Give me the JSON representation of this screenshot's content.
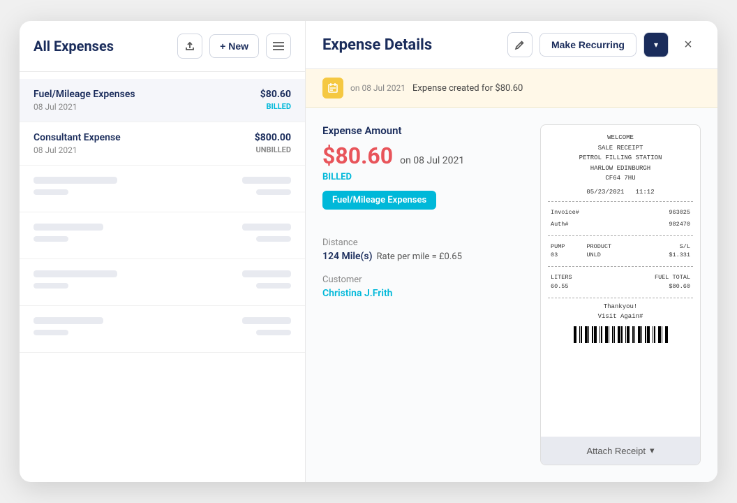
{
  "app": {
    "title": "Expense Details"
  },
  "left_panel": {
    "title": "All Expenses",
    "new_btn": "+ New",
    "upload_icon": "↑",
    "menu_icon": "☰"
  },
  "expenses": [
    {
      "id": 1,
      "name": "Fuel/Mileage Expenses",
      "date": "08 Jul 2021",
      "amount": "$80.60",
      "status": "BILLED",
      "selected": true
    },
    {
      "id": 2,
      "name": "Consultant Expense",
      "date": "08 Jul 2021",
      "amount": "$800.00",
      "status": "UNBILLED",
      "selected": false
    }
  ],
  "detail": {
    "title": "Expense Details",
    "edit_icon": "✏",
    "make_recurring_label": "Make Recurring",
    "dropdown_icon": "▾",
    "close_icon": "×",
    "notification": {
      "icon": "📋",
      "date": "on 08 Jul 2021",
      "text": "Expense created for $80.60"
    },
    "amount_section": {
      "label": "Expense Amount",
      "amount": "$80.60",
      "date": "on 08 Jul 2021",
      "status": "BILLED",
      "category": "Fuel/Mileage Expenses"
    },
    "distance": {
      "label": "Distance",
      "value": "124 Mile(s)",
      "sub": "Rate per mile = £0.65"
    },
    "customer": {
      "label": "Customer",
      "value": "Christina J.Frith"
    }
  },
  "receipt": {
    "lines": [
      "WELCOME",
      "SALE RECEIPT",
      "PETROL FILLING STATION",
      "HARLOW EDINBURGH",
      "CF64 7HU",
      "",
      "05/23/2021     11:12"
    ],
    "invoice_row": {
      "label": "Invoice#",
      "value": "963025"
    },
    "auth_row": {
      "label": "Auth#",
      "value": "982470"
    },
    "pump_row": {
      "pump": "PUMP 03",
      "product": "PRODUCT UNLD",
      "price": "S/L $1.331"
    },
    "liters_row": {
      "liters": "LITERS 60.55",
      "total": "FUEL TOTAL $80.60"
    },
    "footer": [
      "Thankyou!",
      "Visit Again#"
    ],
    "attach_btn": "Attach Receipt"
  }
}
